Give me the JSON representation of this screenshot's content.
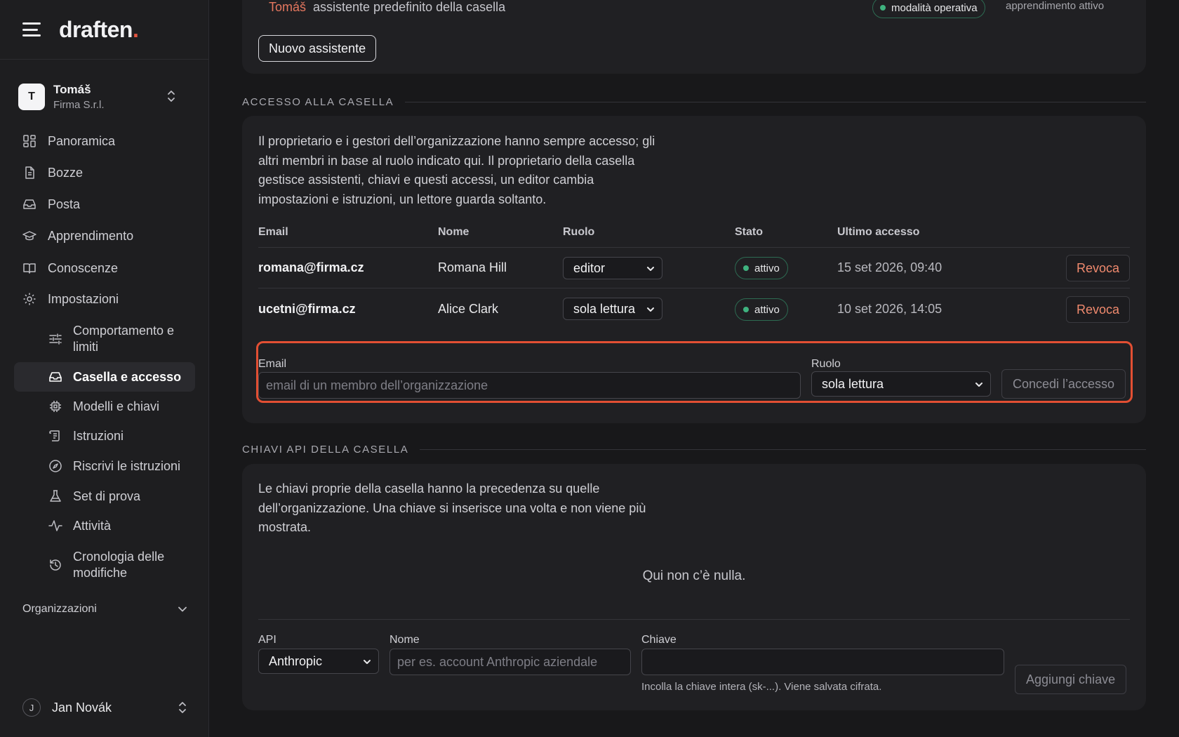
{
  "app": {
    "logo": "draften",
    "logo_dot": "."
  },
  "workspace": {
    "initial": "T",
    "name": "Tomáš",
    "org": "Firma S.r.l."
  },
  "nav": {
    "items": [
      {
        "label": "Panoramica",
        "icon": "dashboard-icon"
      },
      {
        "label": "Bozze",
        "icon": "document-icon"
      },
      {
        "label": "Posta",
        "icon": "inbox-icon"
      },
      {
        "label": "Apprendimento",
        "icon": "graduation-cap-icon"
      },
      {
        "label": "Conoscenze",
        "icon": "book-icon"
      },
      {
        "label": "Impostazioni",
        "icon": "gear-icon"
      }
    ],
    "sub_items": [
      {
        "label": "Comportamento e limiti",
        "icon": "sliders-icon"
      },
      {
        "label": "Casella e accesso",
        "icon": "inbox-icon",
        "active": true
      },
      {
        "label": "Modelli e chiavi",
        "icon": "cpu-icon"
      },
      {
        "label": "Istruzioni",
        "icon": "scroll-icon"
      },
      {
        "label": "Riscrivi le istruzioni",
        "icon": "compass-icon"
      },
      {
        "label": "Set di prova",
        "icon": "flask-icon"
      },
      {
        "label": "Attività",
        "icon": "activity-icon"
      },
      {
        "label": "Cronologia delle modifiche",
        "icon": "history-icon"
      }
    ],
    "organizations_label": "Organizzazioni"
  },
  "user": {
    "initial": "J",
    "name": "Jan Novák"
  },
  "assistants": {
    "name": "Tomáš",
    "description": "assistente predefinito della casella",
    "mode_badge": "modalità operativa",
    "learning": "apprendimento attivo",
    "new_button": "Nuovo assistente"
  },
  "access": {
    "section_title": "ACCESSO ALLA CASELLA",
    "description_lines": [
      "Il proprietario e i gestori dell’organizzazione hanno sempre accesso; gli",
      "altri membri in base al ruolo indicato qui. Il proprietario della casella",
      "gestisce assistenti, chiavi e questi accessi, un editor cambia",
      "impostazioni e istruzioni, un lettore guarda soltanto."
    ],
    "columns": [
      "Email",
      "Nome",
      "Ruolo",
      "Stato",
      "Ultimo accesso"
    ],
    "rows": [
      {
        "email": "romana@firma.cz",
        "name": "Romana Hill",
        "role": "editor",
        "status": "attivo",
        "last_access": "15 set 2026, 09:40",
        "action": "Revoca"
      },
      {
        "email": "ucetni@firma.cz",
        "name": "Alice Clark",
        "role": "sola lettura",
        "status": "attivo",
        "last_access": "10 set 2026, 14:05",
        "action": "Revoca"
      }
    ],
    "grant": {
      "email_label": "Email",
      "email_placeholder": "email di un membro dell’organizzazione",
      "role_label": "Ruolo",
      "role_value": "sola lettura",
      "button": "Concedi l’accesso"
    }
  },
  "api_keys": {
    "section_title": "CHIAVI API DELLA CASELLA",
    "description_lines": [
      "Le chiavi proprie della casella hanno la precedenza su quelle",
      "dell’organizzazione. Una chiave si inserisce una volta e non viene più",
      "mostrata."
    ],
    "empty": "Qui non c’è nulla.",
    "form": {
      "api_label": "API",
      "api_value": "Anthropic",
      "name_label": "Nome",
      "name_placeholder": "per es. account Anthropic aziendale",
      "key_label": "Chiave",
      "key_hint": "Incolla la chiave intera (sk-...). Viene salvata cifrata.",
      "button": "Aggiungi chiave"
    }
  },
  "colors": {
    "accent": "#e5553f",
    "status_green": "#3fb27f",
    "highlight": "#e24f33"
  }
}
